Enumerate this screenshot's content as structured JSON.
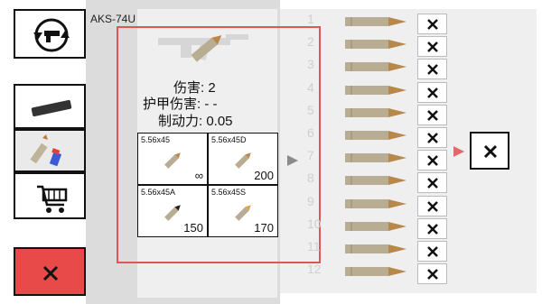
{
  "weapon": {
    "name": "AKS-74U"
  },
  "stats": {
    "damage": "伤害: 2",
    "armor_damage": "护甲伤害: - -",
    "stopping_power": "制动力: 0.05"
  },
  "ammo": [
    {
      "name": "5.56x45",
      "qty": "∞"
    },
    {
      "name": "5.56x45D",
      "qty": "200"
    },
    {
      "name": "5.56x45A",
      "qty": "150"
    },
    {
      "name": "5.56x45S",
      "qty": "170"
    }
  ],
  "slots": [
    "1",
    "2",
    "3",
    "4",
    "5",
    "6",
    "7",
    "8",
    "9",
    "10",
    "11",
    "12"
  ],
  "colors": {
    "accent_red": "#e84a4a",
    "panel": "#efefef"
  },
  "icons": {
    "weapon_swap": "pistol-swap-icon",
    "attachment": "suppressor-icon",
    "ammo_tab": "ammo-icon",
    "shop": "cart-icon",
    "close": "close-icon"
  }
}
